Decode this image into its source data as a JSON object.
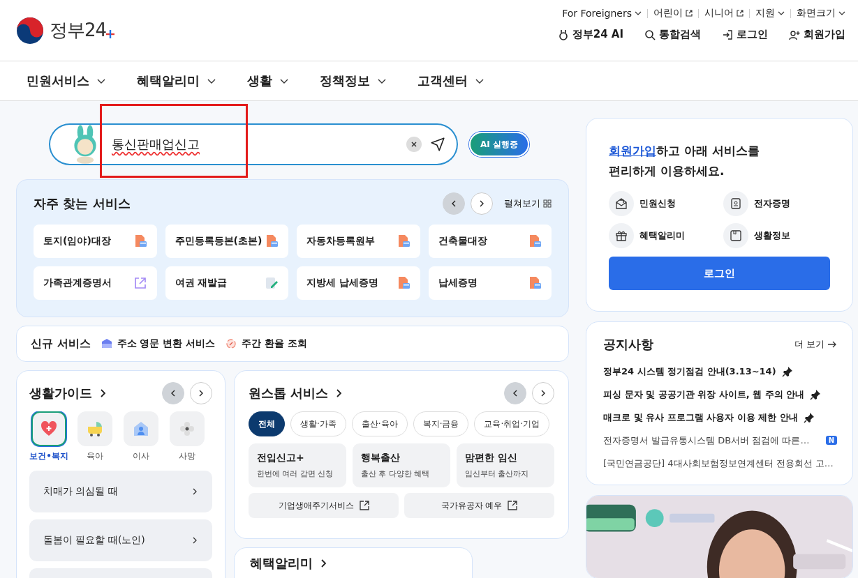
{
  "header": {
    "logo_text": "정부24",
    "utility_links": [
      {
        "label": "For Foreigners",
        "kind": "dropdown"
      },
      {
        "label": "어린이",
        "kind": "external"
      },
      {
        "label": "시니어",
        "kind": "external"
      },
      {
        "label": "지원",
        "kind": "dropdown"
      },
      {
        "label": "화면크기",
        "kind": "dropdown"
      }
    ],
    "actions": [
      {
        "label": "정부24 AI",
        "kind": "ai"
      },
      {
        "label": "통합검색",
        "kind": "search"
      },
      {
        "label": "로그인",
        "kind": "login"
      },
      {
        "label": "회원가입",
        "kind": "signup"
      }
    ]
  },
  "nav": [
    "민원서비스",
    "혜택알리미",
    "생활",
    "정책정보",
    "고객센터"
  ],
  "search": {
    "value": "통신판매업신고",
    "ai_button": "AI 실행중"
  },
  "frequent_services": {
    "title": "자주 찾는 서비스",
    "expand": "펼쳐보기",
    "items": [
      {
        "label": "토지(임야)대장",
        "kind": "pdf"
      },
      {
        "label": "주민등록등본(초본)",
        "kind": "pdf"
      },
      {
        "label": "자동차등록원부",
        "kind": "pdf"
      },
      {
        "label": "건축물대장",
        "kind": "pdf"
      },
      {
        "label": "가족관계증명서",
        "kind": "external"
      },
      {
        "label": "여권 재발급",
        "kind": "edit"
      },
      {
        "label": "지방세 납세증명",
        "kind": "pdf"
      },
      {
        "label": "납세증명",
        "kind": "pdf"
      }
    ]
  },
  "new_services": {
    "label": "신규 서비스",
    "items": [
      {
        "label": "주소 영문 변환 서비스",
        "kind": "card"
      },
      {
        "label": "주간 환율 조회",
        "kind": "exchange"
      }
    ]
  },
  "life_guide": {
    "title": "생활가이드",
    "categories": [
      {
        "label": "보건•복지",
        "kind": "health",
        "selected": true
      },
      {
        "label": "육아",
        "kind": "stroller",
        "selected": false
      },
      {
        "label": "이사",
        "kind": "house",
        "selected": false
      },
      {
        "label": "사망",
        "kind": "flower",
        "selected": false
      }
    ],
    "items": [
      "치매가 의심될 때",
      "돌봄이 필요할 때(노인)"
    ]
  },
  "one_stop": {
    "title": "원스톱 서비스",
    "chips": [
      {
        "label": "전체",
        "selected": true
      },
      {
        "label": "생활·가족",
        "selected": false
      },
      {
        "label": "출산·육아",
        "selected": false
      },
      {
        "label": "복지·금융",
        "selected": false
      },
      {
        "label": "교육·취업·기업",
        "selected": false
      }
    ],
    "services": [
      {
        "title": "전입신고+",
        "desc": "한번에 여러 감면 신청"
      },
      {
        "title": "행복출산",
        "desc": "출산 후 다양한 혜택"
      },
      {
        "title": "맘편한 임신",
        "desc": "임신부터 출산까지"
      }
    ],
    "links": [
      "기업생애주기서비스",
      "국가유공자 예우"
    ]
  },
  "benefit": {
    "title": "혜택알리미"
  },
  "login_card": {
    "signup_link": "회원가입",
    "message": "하고 아래 서비스를",
    "message_line2": "편리하게 이용하세요.",
    "quick": [
      {
        "label": "민원신청",
        "kind": "mail"
      },
      {
        "label": "전자증명",
        "kind": "id"
      },
      {
        "label": "혜택알리미",
        "kind": "gift"
      },
      {
        "label": "생활정보",
        "kind": "book"
      }
    ],
    "button": "로그인"
  },
  "notices": {
    "title": "공지사항",
    "more": "더 보기",
    "items": [
      {
        "text": "정부24 시스템 정기점검 안내(3.13~14)",
        "pinned": true
      },
      {
        "text": "피싱 문자 및 공공기관 위장 사이트, 웹 주의 안내",
        "pinned": true
      },
      {
        "text": "매크로 및 유사 프로그램 사용자 이용 제한 안내",
        "pinned": true
      },
      {
        "text": "전자증명서 발급유통시스템 DB서버 점검에 따른…",
        "pinned": false,
        "badge": "N"
      },
      {
        "text": "[국민연금공단] 4대사회보험정보연계센터 전용회선 고…",
        "pinned": false
      }
    ]
  }
}
